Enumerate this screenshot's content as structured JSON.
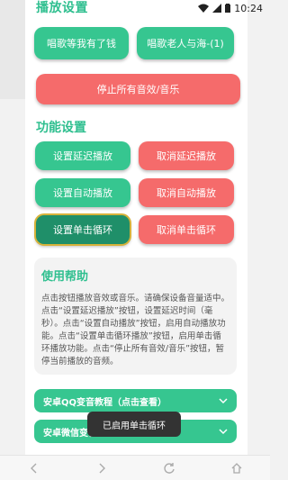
{
  "status_bar": {
    "time": "10:24"
  },
  "top_section": {
    "partial_title": "播放设置",
    "buttons": [
      {
        "label": "唱歌等我有了钱"
      },
      {
        "label": "唱歌老人与海-(1)"
      }
    ],
    "stop_all_label": "停止所有音效/音乐"
  },
  "function_settings": {
    "title": "功能设置",
    "buttons": [
      {
        "label": "设置延迟播放",
        "color": "#36c690"
      },
      {
        "label": "取消延迟播放",
        "color": "#f56b6b"
      },
      {
        "label": "设置自动播放",
        "color": "#36c690"
      },
      {
        "label": "取消自动播放",
        "color": "#f56b6b"
      },
      {
        "label": "设置单击循环",
        "color": "#1f8f69"
      },
      {
        "label": "取消单击循环",
        "color": "#f56b6b"
      }
    ]
  },
  "help": {
    "title": "使用帮助",
    "text": "点击按钮播放音效或音乐。请确保设备音量适中。点击“设置延迟播放”按钮，设置延迟时间（毫秒）。点击“设置自动播放”按钮，启用自动播放功能。点击“设置单击循环播放”按钮，启用单击循环播放功能。点击“停止所有音效/音乐”按钮，暂停当前播放的音频。"
  },
  "accordions": [
    {
      "label": "安卓QQ变音教程（点击查看）"
    },
    {
      "label": "安卓微信变音教程"
    }
  ],
  "toast": {
    "text": "已启用单击循环"
  },
  "colors": {
    "accent": "#2fbf8f",
    "green": "#36c690",
    "red": "#f56b6b",
    "selected": "#1f8f69"
  }
}
